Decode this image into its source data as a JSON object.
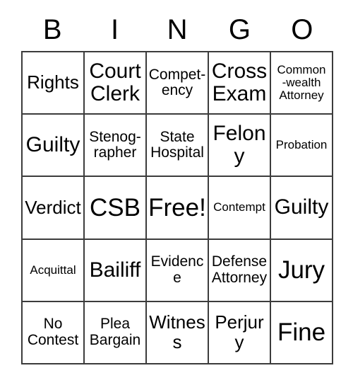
{
  "card": {
    "header_letters": [
      "B",
      "I",
      "N",
      "G",
      "O"
    ],
    "free_space_label": "Free!",
    "rows": [
      [
        {
          "label": "Rights",
          "size": "sz-md"
        },
        {
          "label": "Court\nClerk",
          "size": "sz-lg"
        },
        {
          "label": "Compet-\nency",
          "size": "sz-sm"
        },
        {
          "label": "Cross\nExam",
          "size": "sz-lg"
        },
        {
          "label": "Common\n-wealth\nAttorney",
          "size": "sz-xs"
        }
      ],
      [
        {
          "label": "Guilty",
          "size": "sz-lg"
        },
        {
          "label": "Stenog-\nrapher",
          "size": "sz-sm"
        },
        {
          "label": "State\nHospital",
          "size": "sz-sm"
        },
        {
          "label": "Felony",
          "size": "sz-lg"
        },
        {
          "label": "Probation",
          "size": "sz-xs"
        }
      ],
      [
        {
          "label": "Verdict",
          "size": "sz-md"
        },
        {
          "label": "CSB",
          "size": "sz-xl"
        },
        {
          "label": "Free!",
          "size": "sz-xl"
        },
        {
          "label": "Contempt",
          "size": "sz-xs"
        },
        {
          "label": "Guilty",
          "size": "sz-lg"
        }
      ],
      [
        {
          "label": "Acquittal",
          "size": "sz-xs"
        },
        {
          "label": "Bailiff",
          "size": "sz-lg"
        },
        {
          "label": "Evidence",
          "size": "sz-sm"
        },
        {
          "label": "Defense\nAttorney",
          "size": "sz-sm"
        },
        {
          "label": "Jury",
          "size": "sz-xl"
        }
      ],
      [
        {
          "label": "No\nContest",
          "size": "sz-sm"
        },
        {
          "label": "Plea\nBargain",
          "size": "sz-sm"
        },
        {
          "label": "Witness",
          "size": "sz-md"
        },
        {
          "label": "Perjury",
          "size": "sz-md"
        },
        {
          "label": "Fine",
          "size": "sz-xl"
        }
      ]
    ]
  },
  "colors": {
    "background": "#ffffff",
    "text": "#000000",
    "grid_line": "#3c3c3c"
  }
}
